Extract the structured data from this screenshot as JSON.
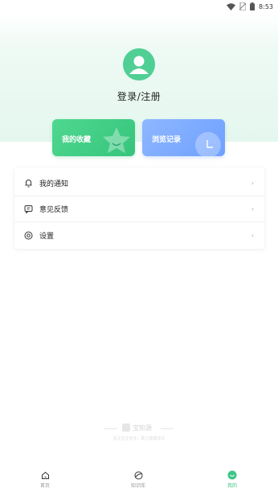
{
  "status_bar": {
    "time": "8:53"
  },
  "profile": {
    "login_label": "登录/注册"
  },
  "cards": {
    "favorites_label": "我的收藏",
    "history_label": "浏览记录"
  },
  "menu": {
    "items": [
      {
        "label": "我的通知",
        "icon": "bell-icon"
      },
      {
        "label": "意见反馈",
        "icon": "feedback-icon"
      },
      {
        "label": "设置",
        "icon": "settings-icon"
      }
    ]
  },
  "brand": {
    "name": "宝知源",
    "slogan": "关注宝宝安全，助力健康成长"
  },
  "tabbar": {
    "tabs": [
      {
        "label": "首页",
        "icon": "home-icon"
      },
      {
        "label": "知识库",
        "icon": "knowledge-icon"
      },
      {
        "label": "我的",
        "icon": "profile-icon"
      }
    ],
    "active_color": "#3fc587"
  },
  "colors": {
    "accent_green": "#4fcf94",
    "card_green": "#3fcc82",
    "card_blue": "#7aa8ff"
  }
}
